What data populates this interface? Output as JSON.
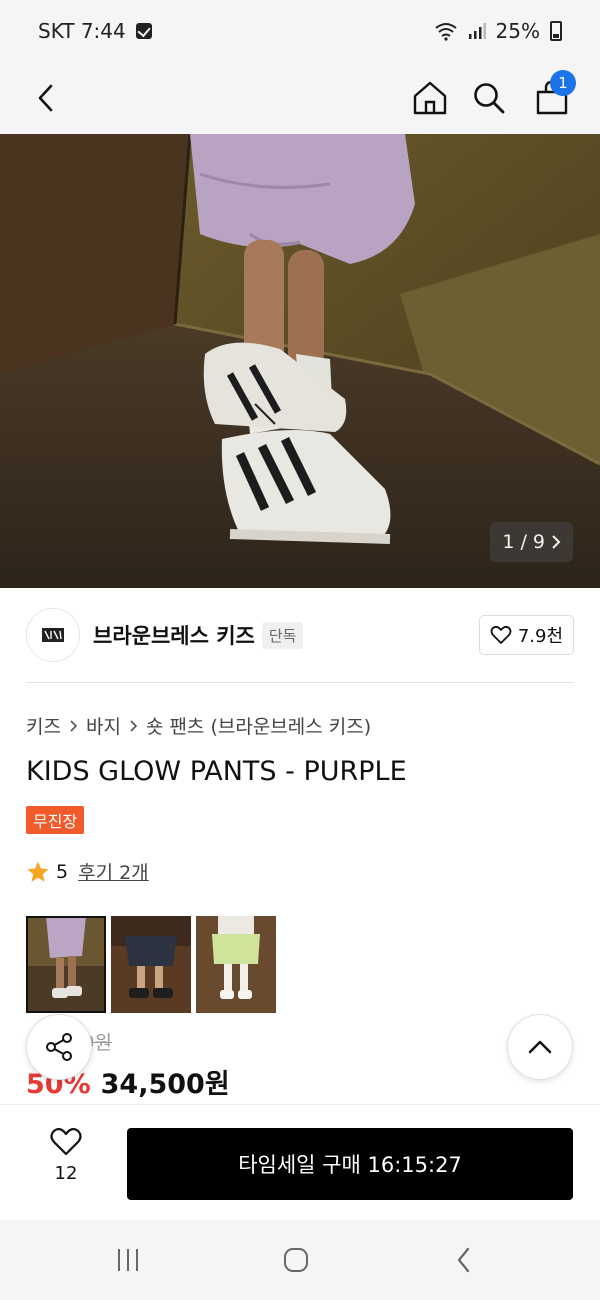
{
  "status_bar": {
    "carrier_time": "SKT 7:44",
    "battery": "25%"
  },
  "header": {
    "cart_count": "1"
  },
  "gallery": {
    "counter": "1 / 9"
  },
  "brand": {
    "name": "브라운브레스 키즈",
    "tag": "단독",
    "likes": "7.9천"
  },
  "breadcrumb": {
    "items": [
      "키즈",
      "바지",
      "숏 팬츠 (브라운브레스 키즈)"
    ]
  },
  "product": {
    "title": "KIDS GLOW PANTS - PURPLE",
    "badge": "무진장",
    "rating": "5",
    "reviews": "후기 2개",
    "original_price": "69,000원",
    "discount": "50%",
    "sale_price": "34,500원"
  },
  "bottom_bar": {
    "wish_count": "12",
    "buy_label": "타임세일 구매 16:15:27"
  },
  "colors": {
    "accent_blue": "#1a73e8",
    "badge_orange": "#f15a2b",
    "discount_red": "#e53935",
    "buy_black": "#000000"
  }
}
